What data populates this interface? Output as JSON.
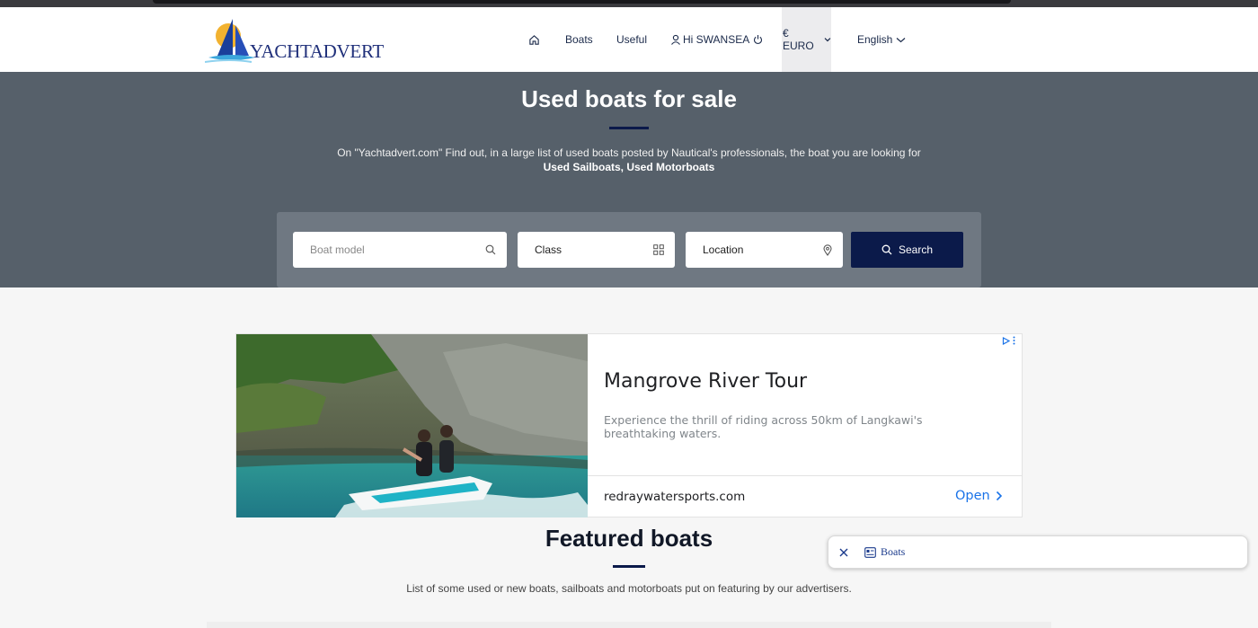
{
  "brand": {
    "name": "YACHTADVERT"
  },
  "nav": {
    "boats": "Boats",
    "useful": "Useful",
    "user": "Hi SWANSEA",
    "currency": "€ EURO",
    "language": "English"
  },
  "hero": {
    "title": "Used boats for sale",
    "description": "On \"Yachtadvert.com\" Find out, in a large list of used boats posted by Nautical's professionals, the boat you are looking for",
    "links": "Used Sailboats, Used Motorboats"
  },
  "search": {
    "model_placeholder": "Boat model",
    "class_label": "Class",
    "location_label": "Location",
    "button_label": "Search"
  },
  "ad": {
    "title": "Mangrove River Tour",
    "text": "Experience the thrill of riding across 50km of Langkawi's breathtaking waters.",
    "domain": "redraywatersports.com",
    "cta": "Open"
  },
  "featured": {
    "title": "Featured boats",
    "description": "List of some used or new boats, sailboats and motorboats put on featuring by our advertisers."
  },
  "toast": {
    "label": "Boats"
  },
  "colors": {
    "navy": "#0b1a4a",
    "hero_bg": "#56606a",
    "link_blue": "#1a73e8"
  }
}
